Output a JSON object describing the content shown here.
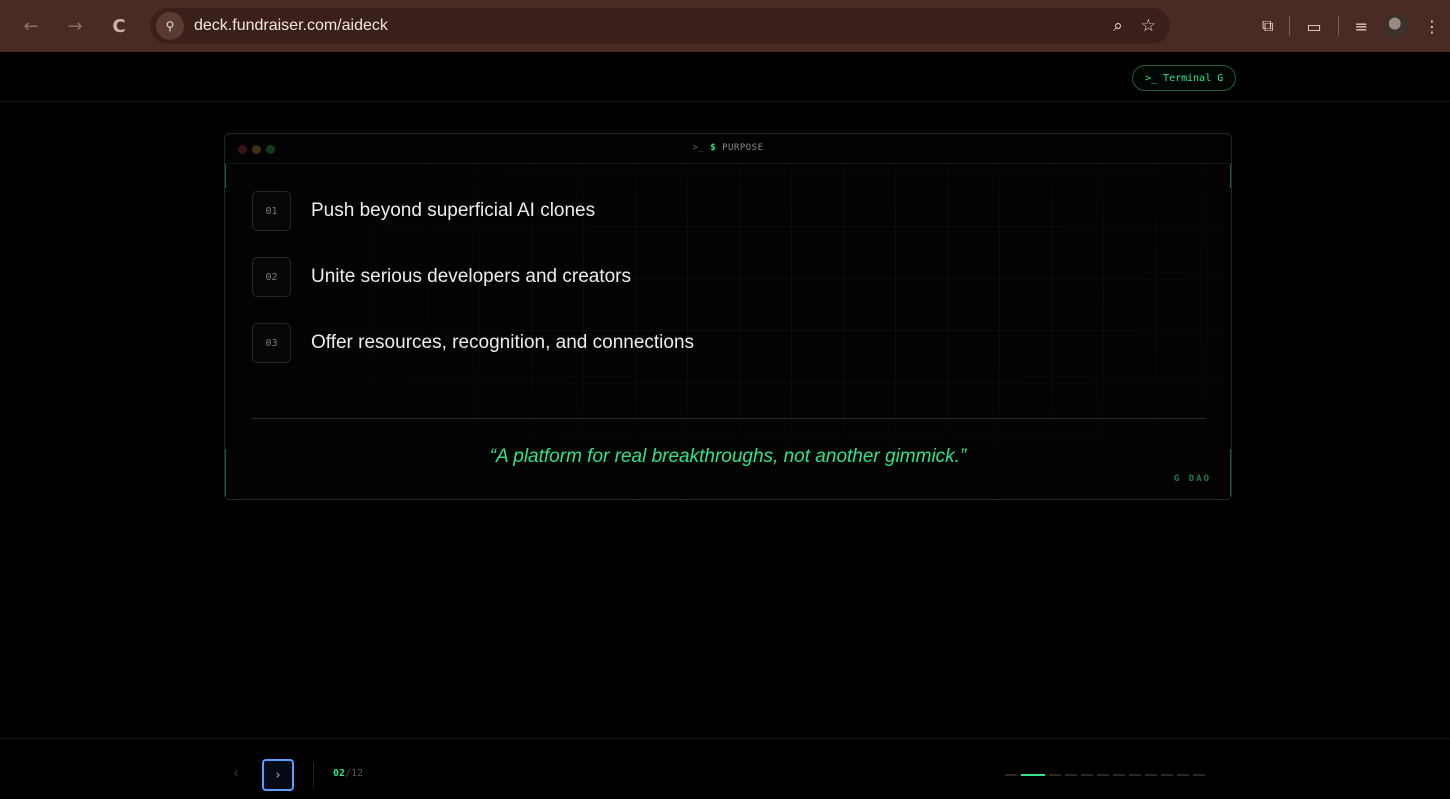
{
  "browser": {
    "back_icon": "←",
    "forward_icon": "→",
    "reload_icon": "C",
    "site_info_icon": "⚲",
    "url": "deck.fundraiser.com/aideck",
    "zoom_icon": "⌕",
    "star_icon": "☆",
    "extensions_icon": "⧉",
    "reading_icon": "▭",
    "media_icon": "≡",
    "menu_icon": "⋮"
  },
  "header": {
    "terminal_prompt": ">_",
    "terminal_label": "Terminal G"
  },
  "window": {
    "prompt": ">_",
    "dollar": "$",
    "title": "PURPOSE",
    "items": [
      {
        "num": "01",
        "text": "Push beyond superficial AI clones"
      },
      {
        "num": "02",
        "text": "Unite serious developers and creators"
      },
      {
        "num": "03",
        "text": "Offer resources, recognition, and connections"
      }
    ],
    "quote": "“A platform for real breakthroughs, not another gimmick.”",
    "signature": "G DAO"
  },
  "footer": {
    "prev_icon": "‹",
    "next_icon": "›",
    "current_slide": "02",
    "total_slides": "/12",
    "progress_segments": 12,
    "active_segment": 2
  },
  "colors": {
    "accent": "#2fe38a",
    "browser_chrome": "#4a2a24",
    "focus_ring": "#5b9cff"
  }
}
